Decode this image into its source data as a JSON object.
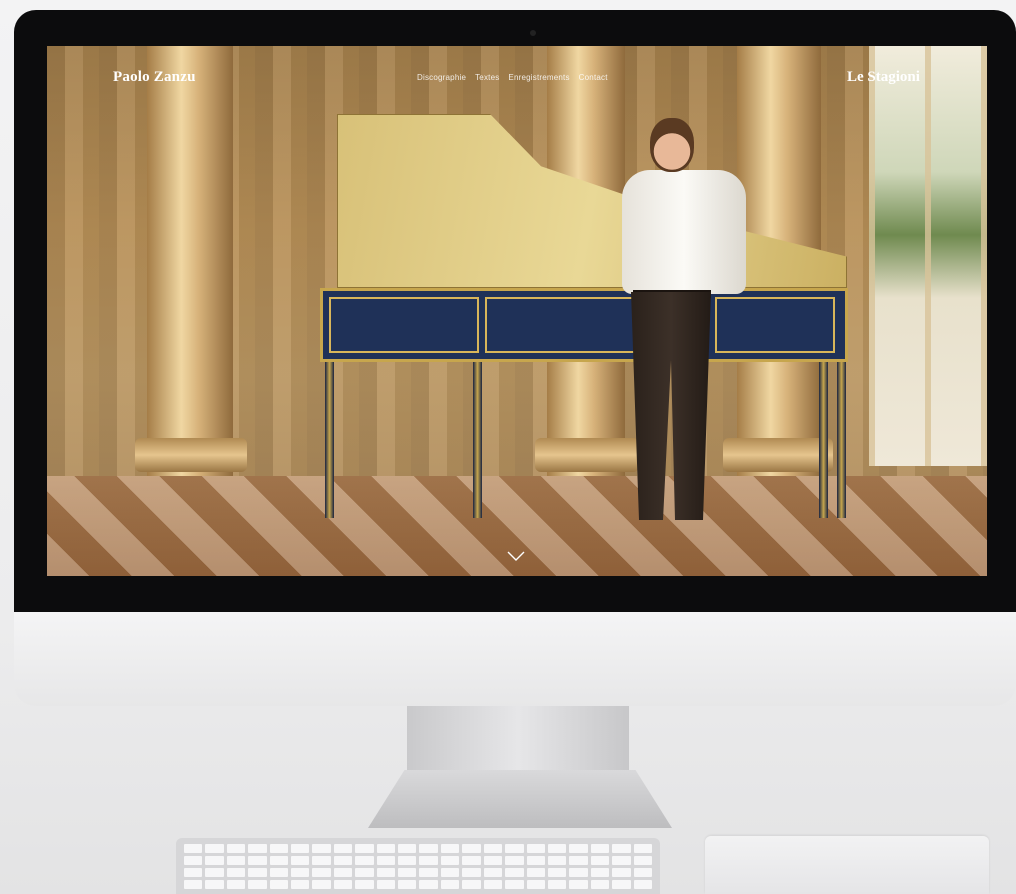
{
  "site": {
    "brand": "Paolo Zanzu",
    "ensemble_link": "Le Stagioni",
    "nav": [
      {
        "label": "Discographie"
      },
      {
        "label": "Textes"
      },
      {
        "label": "Enregistrements"
      },
      {
        "label": "Contact"
      }
    ]
  },
  "icons": {
    "scroll": "chevron-down-icon"
  },
  "colors": {
    "nav_text": "#ffffff",
    "bezel": "#0c0c0d",
    "harpsichord_case": "#1f3158",
    "gold_trim": "#c7a64d"
  }
}
